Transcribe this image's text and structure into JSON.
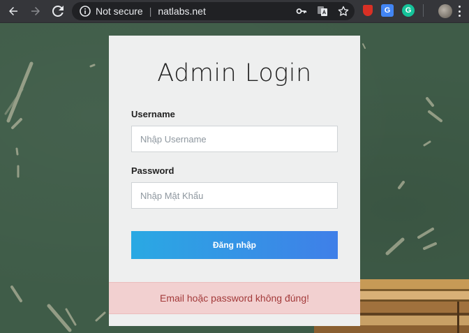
{
  "browser": {
    "security_label": "Not secure",
    "url": "natlabs.net",
    "extensions": {
      "translate_label": "G",
      "grammarly_label": "G"
    }
  },
  "login": {
    "title": "Admin Login",
    "username_label": "Username",
    "username_placeholder": "Nhập Username",
    "username_value": "",
    "password_label": "Password",
    "password_placeholder": "Nhập Mật Khẩu",
    "password_value": "",
    "submit_label": "Đăng nhập",
    "error_message": "Email hoặc password không đúng!"
  },
  "colors": {
    "chalkboard": "#3f5c48",
    "card": "#eeefef",
    "button_start": "#2aa9e3",
    "button_end": "#3f7fe8",
    "error_bg": "#f2d0d0",
    "error_text": "#a33a3a"
  }
}
